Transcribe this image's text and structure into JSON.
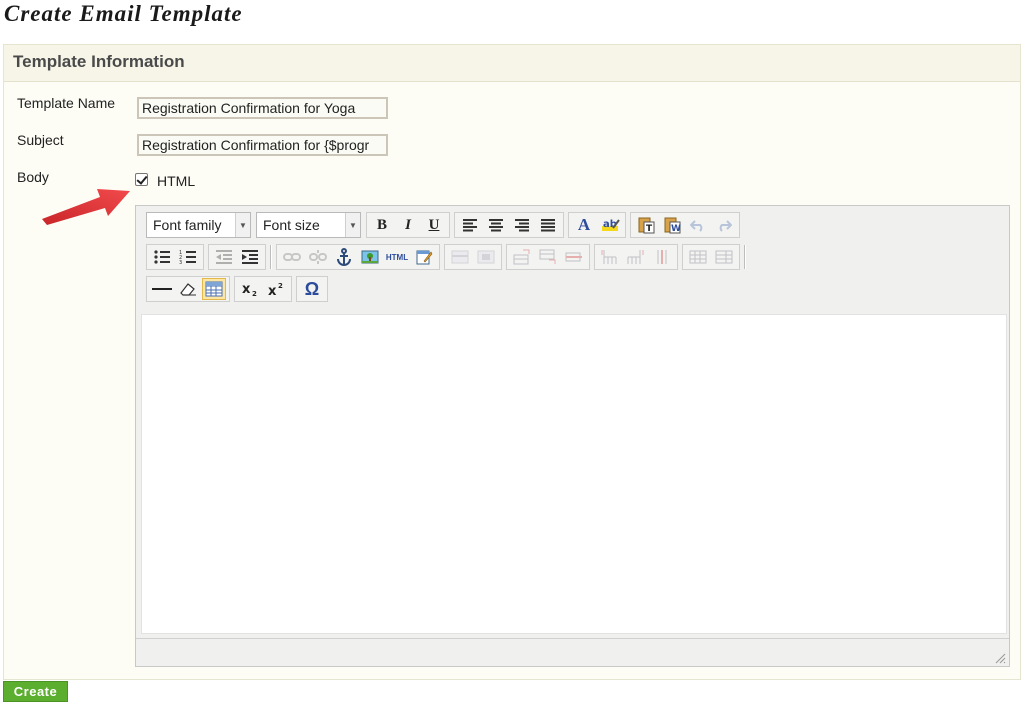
{
  "page": {
    "title": "Create Email Template"
  },
  "panel": {
    "header": "Template Information"
  },
  "form": {
    "template_name_label": "Template Name",
    "template_name_value": "Registration Confirmation for Yoga",
    "subject_label": "Subject",
    "subject_value": "Registration Confirmation for {$progr",
    "body_label": "Body",
    "html_checkbox_label": "HTML",
    "html_checked": true
  },
  "editor": {
    "font_family": "Font family",
    "font_size": "Font size",
    "bold": "B",
    "italic": "I",
    "underline": "U",
    "html_button": "HTML",
    "omega": "Ω"
  },
  "actions": {
    "create_label": "Create"
  },
  "colors": {
    "create_button": "#5bae2e",
    "arrow": "#e8373a",
    "panel_header_bg": "#f6f5e8"
  },
  "icons": [
    "align-left-icon",
    "align-center-icon",
    "align-right-icon",
    "align-justify-icon",
    "font-color-icon",
    "highlight-icon",
    "paste-text-icon",
    "paste-word-icon",
    "undo-icon",
    "redo-icon",
    "bullet-list-icon",
    "numbered-list-icon",
    "outdent-icon",
    "indent-icon",
    "link-icon",
    "unlink-icon",
    "anchor-icon",
    "image-icon",
    "edit-icon",
    "table-icon",
    "subscript-icon",
    "superscript-icon",
    "horizontal-rule-icon",
    "eraser-icon",
    "omega-icon",
    "red-arrow-annotation"
  ]
}
